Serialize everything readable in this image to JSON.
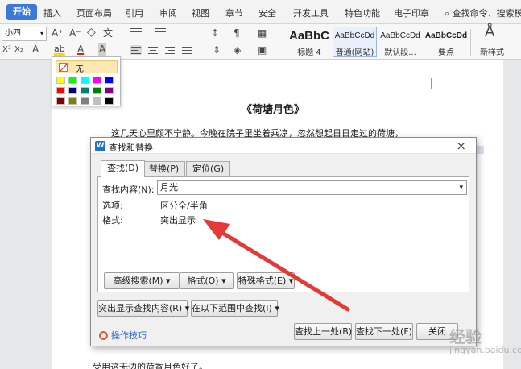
{
  "ribbon_tabs": [
    {
      "label": "开始",
      "active": true
    },
    {
      "label": "插入"
    },
    {
      "label": "页面布局"
    },
    {
      "label": "引用"
    },
    {
      "label": "审阅"
    },
    {
      "label": "视图"
    },
    {
      "label": "章节"
    },
    {
      "label": "安全"
    },
    {
      "label": "开发工具"
    },
    {
      "label": "特色功能"
    },
    {
      "label": "电子印章"
    }
  ],
  "search_command": "查找命令、搜索模",
  "toolbar": {
    "font_size": "小四",
    "grow_font": "A⁺",
    "shrink_font": "A⁻",
    "clear_format": "◇",
    "phonetic": "文",
    "highlight": "ab",
    "font_color": "A",
    "char_shading": "A",
    "bold_x": "X²",
    "x_sub": "X₂",
    "text_effect": "A",
    "new_style": "新样式"
  },
  "styles": [
    {
      "preview": "AaBbC",
      "caption": "标题 4",
      "selected": false
    },
    {
      "preview": "AaBbCcDd",
      "caption": "普通(网站)",
      "selected": true
    },
    {
      "preview": "AaBbCcDd",
      "caption": "默认段...",
      "selected": false
    },
    {
      "preview": "AaBbCcDd",
      "caption": "要点",
      "selected": false
    }
  ],
  "color_popup": {
    "no_color_label": "无",
    "colors": [
      "#ffff00",
      "#00ff00",
      "#00ffff",
      "#ff00ff",
      "#0000ff",
      "#ff0000",
      "#000080",
      "#008080",
      "#008000",
      "#800080",
      "#800000",
      "#808000",
      "#808080",
      "#c0c0c0",
      "#000000"
    ]
  },
  "document": {
    "title": "《荷塘月色》",
    "line1": "这几天心里颇不宁静。今晚在院子里坐着乘凉，忽然想起日日走过的荷塘，",
    "bottom_line": "受用这无边的荷香月色好了。"
  },
  "dialog": {
    "title": "查找和替换",
    "close": "×",
    "tabs": [
      {
        "label": "查找(D)",
        "active": true
      },
      {
        "label": "替换(P)"
      },
      {
        "label": "定位(G)"
      }
    ],
    "find_label": "查找内容(N):",
    "find_value": "月光",
    "options_label": "选项:",
    "options_value": "区分全/半角",
    "format_label": "格式:",
    "format_value": "突出显示",
    "buttons": {
      "advanced": "高级搜索(M) ▾",
      "format": "格式(O) ▾",
      "special": "特殊格式(E) ▾",
      "highlight_find": "突出显示查找内容(R) ▾",
      "find_in": "在以下范围中查找(I) ▾",
      "find_prev": "查找上一处(B)",
      "find_next": "查找下一处(F)",
      "close": "关闭"
    },
    "tips": "操作技巧"
  },
  "watermark": {
    "text": "经验",
    "url": "jingyan.baidu.com"
  },
  "colors": {
    "accent": "#3c78d8",
    "arrow": "#e53935"
  }
}
